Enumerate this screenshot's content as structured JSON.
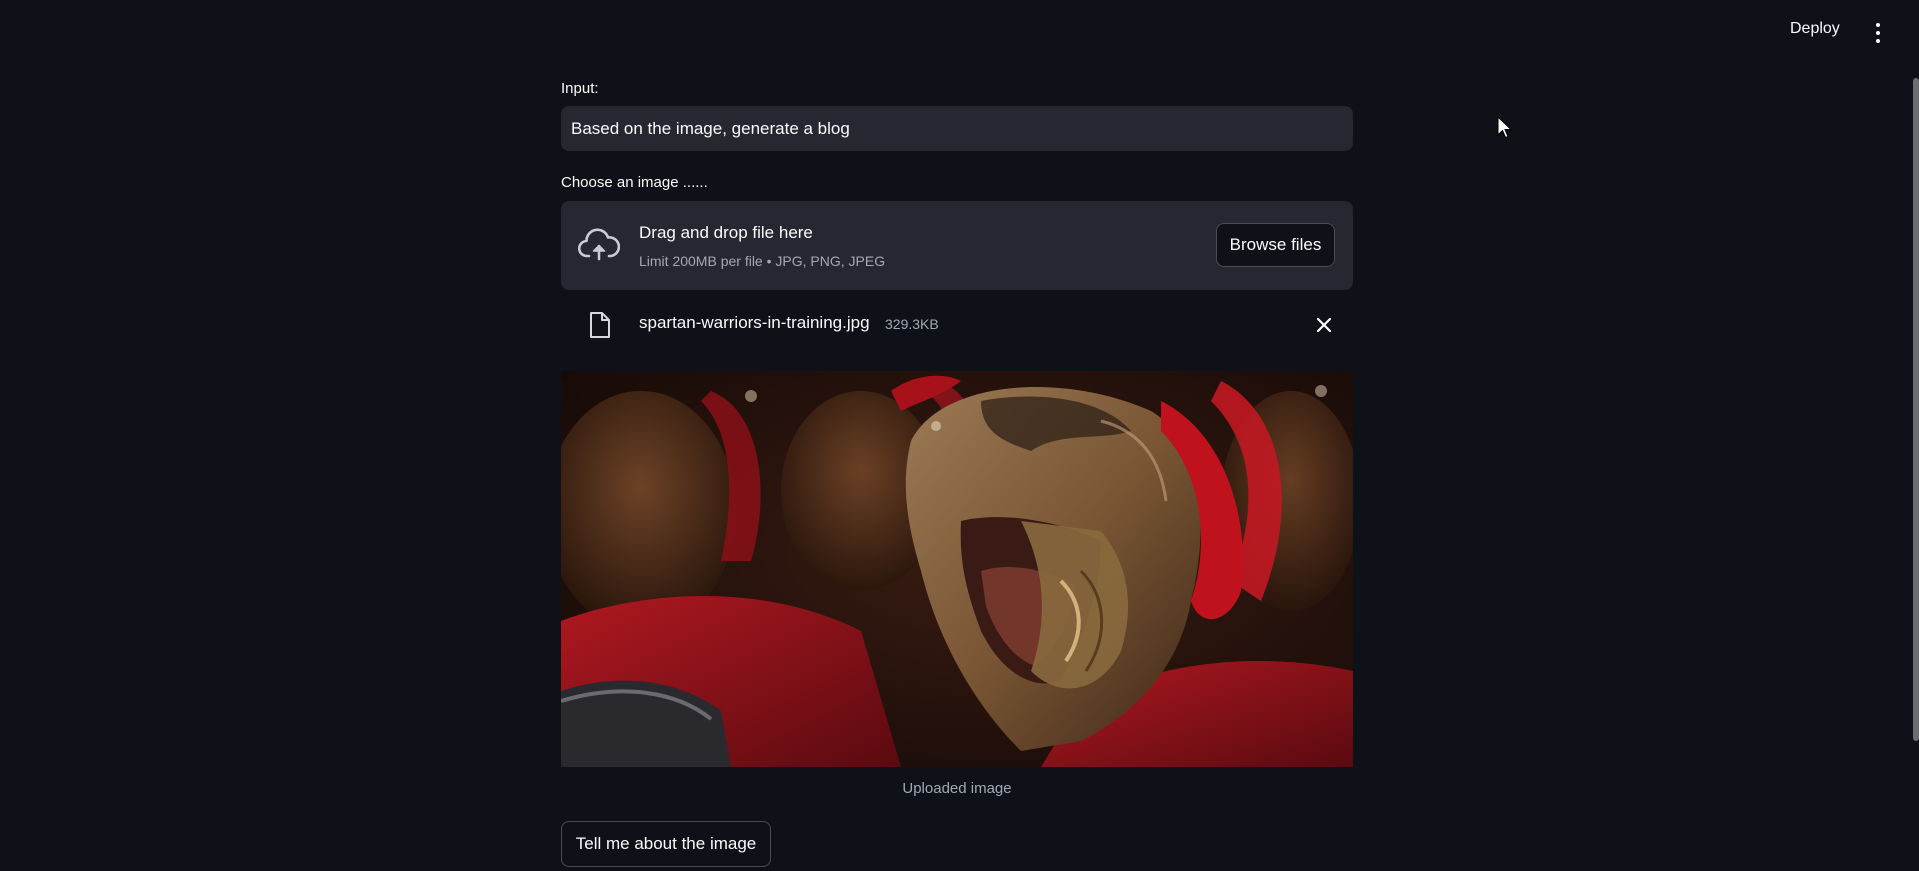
{
  "header": {
    "deploy_label": "Deploy",
    "menu_icon": "kebab-menu-icon"
  },
  "form": {
    "input_label": "Input:",
    "input_value": "Based on the image, generate a blog",
    "uploader_label": "Choose an image ......",
    "dropzone_title": "Drag and drop file here",
    "dropzone_limit": "Limit 200MB per file • JPG, PNG, JPEG",
    "browse_label": "Browse files",
    "upload_icon": "cloud-upload-icon"
  },
  "uploaded_file": {
    "name": "spartan-warriors-in-training.jpg",
    "size": "329.3KB",
    "file_icon": "file-icon",
    "remove_icon": "close-icon"
  },
  "image": {
    "caption": "Uploaded image"
  },
  "actions": {
    "describe_label": "Tell me about the image"
  },
  "colors": {
    "background": "#0e1117",
    "widget_background": "#262730",
    "text": "#fafafa",
    "muted_text": "#a3a8b8"
  }
}
